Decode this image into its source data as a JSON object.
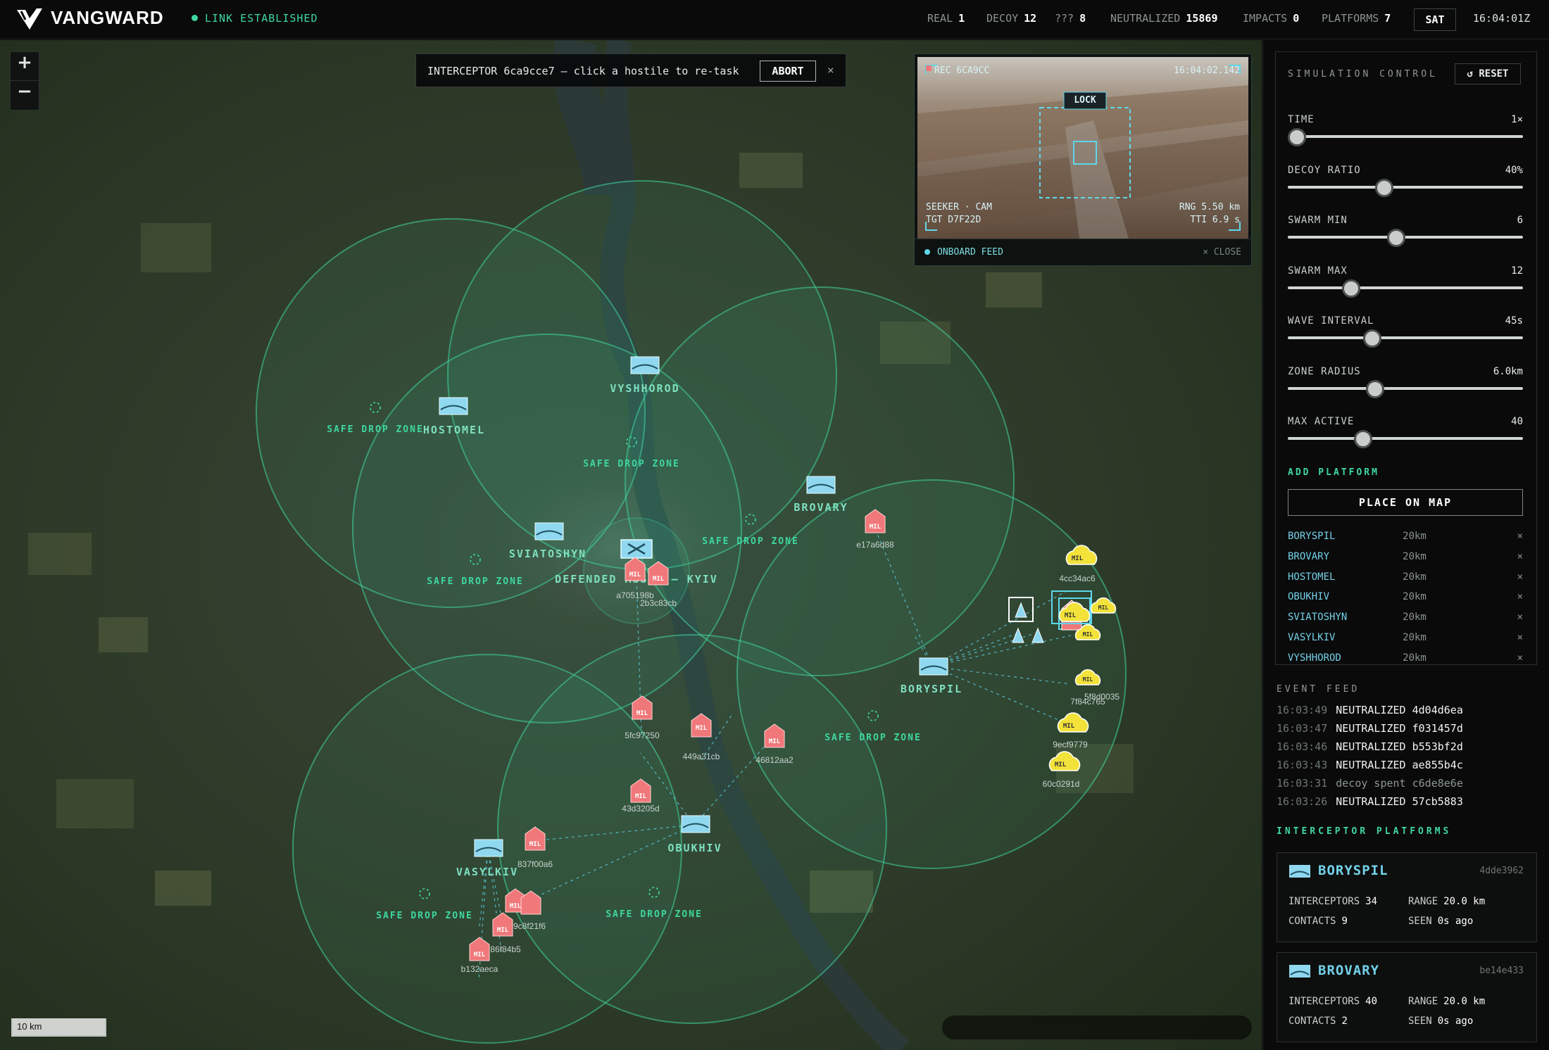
{
  "app": {
    "brand": "VANGWARD",
    "link_status": "LINK ESTABLISHED"
  },
  "stats": {
    "real_label": "REAL",
    "real": "1",
    "decoy_label": "DECOY",
    "decoy": "12",
    "unknown_label": "???",
    "unknown": "8",
    "neutralized_label": "NEUTRALIZED",
    "neutralized": "15869",
    "impacts_label": "IMPACTS",
    "impacts": "0",
    "platforms_label": "PLATFORMS",
    "platforms": "7"
  },
  "header": {
    "sat_label": "SAT",
    "clock": "16:04:01Z"
  },
  "task": {
    "text": "INTERCEPTOR 6ca9cce7 — click a hostile to re-task",
    "abort_label": "ABORT",
    "close": "×"
  },
  "feed": {
    "rec": "REC 6CA9CC",
    "time": "16:04:02.142",
    "lock": "LOCK",
    "seeker": "SEEKER · CAM",
    "tgt": "TGT D7F22D",
    "rng": "RNG 5.50 km",
    "tti": "TTI 6.9 s",
    "onboard": "ONBOARD FEED",
    "close": "× CLOSE"
  },
  "map": {
    "scale": "10 km",
    "zones": [
      {
        "label": "SAFE DROP ZONE"
      }
    ],
    "cities": [
      "VYSHHOROD",
      "HOSTOMEL",
      "BROVARY",
      "SVIATOSHYN",
      "DEFENDED ASSET — KYIV",
      "BORYSPIL",
      "OBUKHIV",
      "VASYLKIV"
    ],
    "tracks": [
      {
        "id": "e17a6d88",
        "kind": "MIL"
      },
      {
        "id": "a705198b",
        "kind": "MIL"
      },
      {
        "id": "2b3c83cb",
        "kind": "MIL"
      },
      {
        "id": "5fc97250",
        "kind": "MIL"
      },
      {
        "id": "449a31cb",
        "kind": "MIL"
      },
      {
        "id": "46812aa2",
        "kind": "MIL"
      },
      {
        "id": "43d3205d",
        "kind": "MIL"
      },
      {
        "id": "837f00a6",
        "kind": "MIL"
      },
      {
        "id": "9c8f21f6",
        "kind": "MIL"
      },
      {
        "id": "86f84b5",
        "kind": "MIL"
      },
      {
        "id": "b132aeca",
        "kind": "MIL"
      },
      {
        "id": "4cc34ac6",
        "kind": "MIL"
      },
      {
        "id": "9ecf9779",
        "kind": "MIL"
      },
      {
        "id": "60c0291d",
        "kind": "MIL"
      },
      {
        "id": "7f84c765",
        "kind": "MIL"
      },
      {
        "id": "5f8d0035",
        "kind": "MIL"
      }
    ]
  },
  "sim": {
    "title": "SIMULATION CONTROL",
    "reset": "↺ RESET",
    "sliders": [
      {
        "name": "TIME",
        "value": "1×",
        "pos": 0.04
      },
      {
        "name": "DECOY RATIO",
        "value": "40%",
        "pos": 0.41
      },
      {
        "name": "SWARM MIN",
        "value": "6",
        "pos": 0.46
      },
      {
        "name": "SWARM MAX",
        "value": "12",
        "pos": 0.27
      },
      {
        "name": "WAVE INTERVAL",
        "value": "45s",
        "pos": 0.36
      },
      {
        "name": "ZONE RADIUS",
        "value": "6.0km",
        "pos": 0.37
      },
      {
        "name": "MAX ACTIVE",
        "value": "40",
        "pos": 0.32
      }
    ],
    "add_title": "ADD PLATFORM",
    "place_label": "PLACE ON MAP",
    "platforms": [
      {
        "name": "BORYSPIL",
        "range": "20km",
        "x": "×"
      },
      {
        "name": "BROVARY",
        "range": "20km",
        "x": "×"
      },
      {
        "name": "HOSTOMEL",
        "range": "20km",
        "x": "×"
      },
      {
        "name": "OBUKHIV",
        "range": "20km",
        "x": "×"
      },
      {
        "name": "SVIATOSHYN",
        "range": "20km",
        "x": "×"
      },
      {
        "name": "VASYLKIV",
        "range": "20km",
        "x": "×"
      },
      {
        "name": "VYSHHOROD",
        "range": "20km",
        "x": "×"
      }
    ]
  },
  "events": {
    "title": "EVENT FEED",
    "items": [
      {
        "t": "16:03:49",
        "msg": "NEUTRALIZED 4d04d6ea"
      },
      {
        "t": "16:03:47",
        "msg": "NEUTRALIZED f031457d"
      },
      {
        "t": "16:03:46",
        "msg": "NEUTRALIZED b553bf2d"
      },
      {
        "t": "16:03:43",
        "msg": "NEUTRALIZED ae855b4c"
      },
      {
        "t": "16:03:31",
        "msg": "decoy spent c6de8e6e"
      },
      {
        "t": "16:03:26",
        "msg": "NEUTRALIZED 57cb5883"
      }
    ]
  },
  "interceptor_platforms": {
    "title": "INTERCEPTOR PLATFORMS",
    "cards": [
      {
        "name": "BORYSPIL",
        "id": "4dde3962",
        "interceptors_label": "INTERCEPTORS",
        "interceptors": "34",
        "range_label": "RANGE",
        "range": "20.0 km",
        "contacts_label": "CONTACTS",
        "contacts": "9",
        "seen_label": "SEEN",
        "seen": "0s ago"
      },
      {
        "name": "BROVARY",
        "id": "be14e433",
        "interceptors_label": "INTERCEPTORS",
        "interceptors": "40",
        "range_label": "RANGE",
        "range": "20.0 km",
        "contacts_label": "CONTACTS",
        "contacts": "2",
        "seen_label": "SEEN",
        "seen": "0s ago"
      }
    ]
  },
  "colors": {
    "accent": "#3fd7a0",
    "platform": "#73d1ea",
    "hostile": "#f0787a",
    "unknown": "#f2e23a"
  }
}
